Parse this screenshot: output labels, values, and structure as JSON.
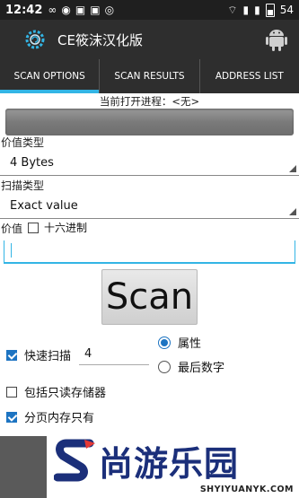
{
  "status_bar": {
    "time": "12:42",
    "battery": "54"
  },
  "app": {
    "title": "CE筱沫汉化版"
  },
  "tabs": [
    {
      "label": "SCAN OPTIONS",
      "active": true
    },
    {
      "label": "SCAN RESULTS",
      "active": false
    },
    {
      "label": "ADDRESS LIST",
      "active": false
    }
  ],
  "process": {
    "label": "当前打开进程：<无>"
  },
  "value_type": {
    "label": "价值类型",
    "selected": "4 Bytes"
  },
  "scan_type": {
    "label": "扫描类型",
    "selected": "Exact value"
  },
  "value": {
    "label": "价值",
    "hex_label": "十六进制",
    "hex_checked": false,
    "input": ""
  },
  "scan_button": {
    "label": "Scan"
  },
  "fast_scan": {
    "label": "快速扫描",
    "checked": true,
    "value": "4"
  },
  "alignment": {
    "property_label": "属性",
    "last_digit_label": "最后数字",
    "selected": "property"
  },
  "readonly_memory": {
    "label": "包括只读存储器",
    "checked": false
  },
  "paged_memory": {
    "label": "分页内存只有",
    "checked": true
  },
  "watermark": {
    "brand": "尚游乐园",
    "url": "SHYIYUANYK.COM"
  },
  "colors": {
    "accent": "#33b5e5",
    "bar": "#2e2e2e",
    "check": "#1d74c2",
    "watermark": "#1b2f7a"
  }
}
